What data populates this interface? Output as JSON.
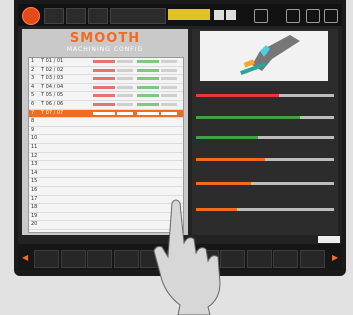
{
  "brand": {
    "title": "SMOOTH",
    "subtitle": "MACHINING CONFIG"
  },
  "rows": [
    {
      "num": "1",
      "name": "T 01 / 01",
      "selected": false
    },
    {
      "num": "2",
      "name": "T 02 / 02",
      "selected": false
    },
    {
      "num": "3",
      "name": "T 03 / 03",
      "selected": false
    },
    {
      "num": "4",
      "name": "T 04 / 04",
      "selected": false
    },
    {
      "num": "5",
      "name": "T 05 / 05",
      "selected": false
    },
    {
      "num": "6",
      "name": "T 06 / 06",
      "selected": false
    },
    {
      "num": "7",
      "name": "T 07 / 07",
      "selected": true
    },
    {
      "num": "8",
      "name": "",
      "selected": false
    },
    {
      "num": "9",
      "name": "",
      "selected": false
    },
    {
      "num": "10",
      "name": "",
      "selected": false
    },
    {
      "num": "11",
      "name": "",
      "selected": false
    },
    {
      "num": "12",
      "name": "",
      "selected": false
    },
    {
      "num": "13",
      "name": "",
      "selected": false
    },
    {
      "num": "14",
      "name": "",
      "selected": false
    },
    {
      "num": "15",
      "name": "",
      "selected": false
    },
    {
      "num": "16",
      "name": "",
      "selected": false
    },
    {
      "num": "17",
      "name": "",
      "selected": false
    },
    {
      "num": "18",
      "name": "",
      "selected": false
    },
    {
      "num": "19",
      "name": "",
      "selected": false
    },
    {
      "num": "20",
      "name": "",
      "selected": false
    }
  ],
  "sliders": [
    {
      "label": "",
      "fill": 0.6,
      "color": "#e53935"
    },
    {
      "label": "",
      "fill": 0.75,
      "color": "#43a047"
    },
    {
      "label": "",
      "fill": 0.45,
      "color": "#43a047"
    },
    {
      "label": "",
      "fill": 0.5,
      "color": "#f26b21"
    },
    {
      "label": "",
      "fill": 0.4,
      "color": "#f26b21"
    },
    {
      "label": "",
      "fill": 0.3,
      "color": "#f26b21"
    }
  ],
  "fkeys": [
    "",
    "",
    "",
    "",
    "",
    "",
    "",
    "",
    "",
    "",
    ""
  ],
  "colors": {
    "accent": "#f26b21",
    "selected_row": "#f26b21"
  }
}
